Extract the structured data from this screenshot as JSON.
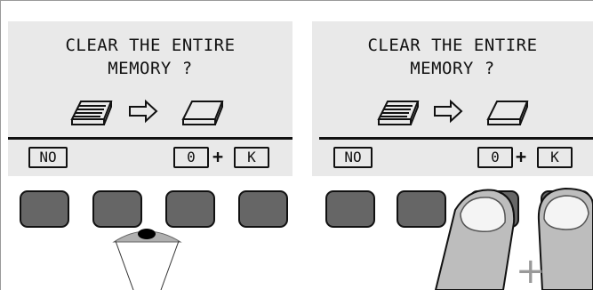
{
  "screens": [
    {
      "title_line1": "CLEAR THE ENTIRE",
      "title_line2": "MEMORY ?",
      "no_key": "NO",
      "zero_key": "0",
      "plus": "+",
      "k_key": "K"
    },
    {
      "title_line1": "CLEAR THE ENTIRE",
      "title_line2": "MEMORY ?",
      "no_key": "NO",
      "zero_key": "0",
      "plus": "+",
      "k_key": "K"
    }
  ],
  "icons": [
    "memory-full-icon",
    "arrow-right-icon",
    "memory-empty-icon"
  ],
  "fingers_plus": "+",
  "colors": {
    "screen": "#e9e9e9",
    "button": "#666666",
    "finger": "#bdbdbd"
  }
}
